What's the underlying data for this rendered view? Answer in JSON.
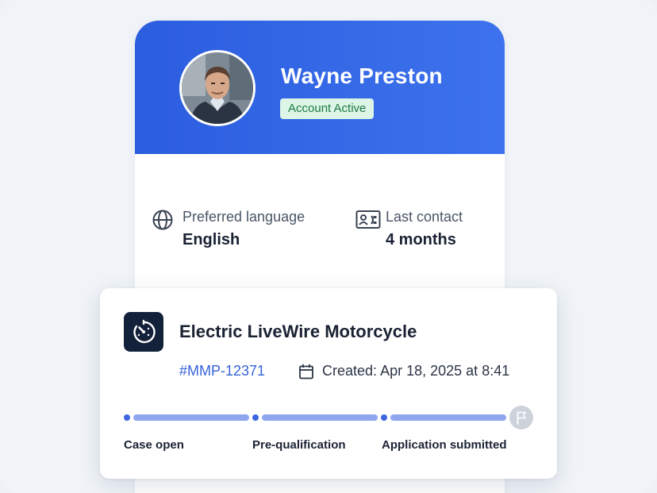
{
  "profile": {
    "name": "Wayne Preston",
    "status": "Account Active",
    "avatar_icon": "avatar-photo"
  },
  "info": {
    "language": {
      "label": "Preferred language",
      "value": "English",
      "icon": "globe-icon"
    },
    "contact": {
      "label": "Last contact",
      "value": "4 months",
      "icon": "contact-card-icon"
    }
  },
  "case": {
    "icon": "gauge-icon",
    "title": "Electric LiveWire Motorcycle",
    "id": "#MMP-12371",
    "calendar_icon": "calendar-icon",
    "created_label": "Created:",
    "created_date": "Apr 18, 2025",
    "created_at_word": "at",
    "created_time": "8:41",
    "steps": [
      {
        "label": "Case open"
      },
      {
        "label": "Pre-qualification"
      },
      {
        "label": "Application submitted"
      }
    ],
    "final_step_icon": "flag-icon"
  },
  "colors": {
    "header_blue": "#2b5ddf",
    "badge_bg": "#dcf5e6",
    "badge_text": "#1e7a44",
    "link_blue": "#3563d8",
    "progress": "#8fa6ee"
  }
}
